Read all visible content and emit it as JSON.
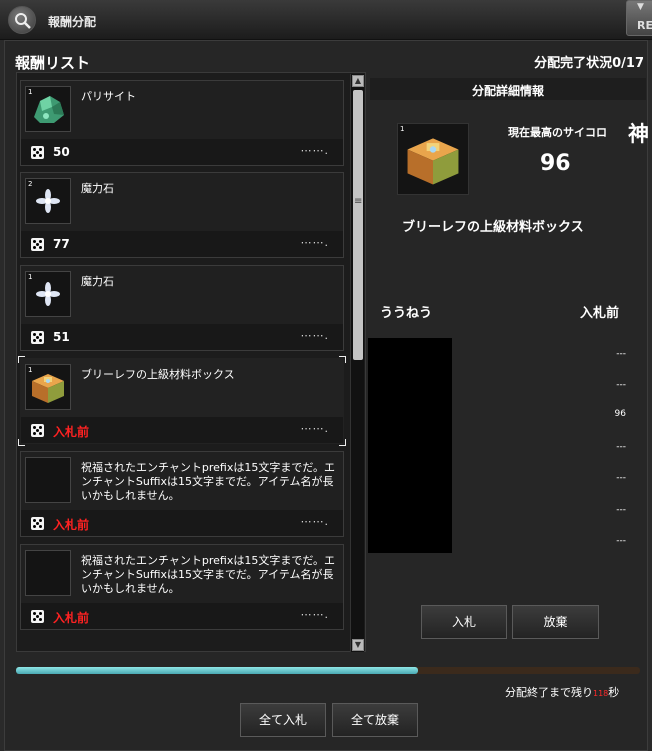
{
  "window": {
    "title": "報酬分配",
    "corner_button_label": "RE"
  },
  "header": {
    "list_title": "報酬リスト",
    "progress_status": "分配完了状況0/17"
  },
  "list_items": [
    {
      "qty": "1",
      "name": "パリサイト",
      "score": "50",
      "score_red": false,
      "icon": "green-ore-icon"
    },
    {
      "qty": "2",
      "name": "魔力石",
      "score": "77",
      "score_red": false,
      "icon": "magic-stone-icon"
    },
    {
      "qty": "1",
      "name": "魔力石",
      "score": "51",
      "score_red": false,
      "icon": "magic-stone-icon"
    },
    {
      "qty": "1",
      "name": "ブリーレフの上級材料ボックス",
      "score": "入札前",
      "score_red": true,
      "icon": "material-box-icon"
    },
    {
      "qty": "",
      "name": "祝福されたエンチャントprefixは15文字までだ。エンチャントSuffixは15文字までだ。アイテム名が長いかもしれません。",
      "score": "入札前",
      "score_red": true,
      "icon": "empty-slot"
    },
    {
      "qty": "",
      "name": "祝福されたエンチャントprefixは15文字までだ。エンチャントSuffixは15文字までだ。アイテム名が長いかもしれません。",
      "score": "入札前",
      "score_red": true,
      "icon": "empty-slot"
    }
  ],
  "more_indicator": "⋯⋯.",
  "detail": {
    "title": "分配詳細情報",
    "item_qty": "1",
    "highest_roll_label": "現在最高のサイコロ",
    "god_glyph": "神",
    "highest_roll_value": "96",
    "item_name": "ブリーレフの上級材料ボックス",
    "bidder_header": "ううねう",
    "bid_status_header": "入札前",
    "bid_values": [
      "---",
      "---",
      "96",
      "---",
      "---",
      "---",
      "---"
    ]
  },
  "buttons": {
    "bid": "入札",
    "pass": "放棄",
    "bid_all": "全て入札",
    "pass_all": "全て放棄"
  },
  "timer": {
    "progress": 0.645,
    "label_prefix": "分配終了まで残り",
    "seconds": "118",
    "label_suffix": "秒"
  },
  "colors": {
    "accent_red": "#ff2222",
    "timer_fill": "#6cc9cf"
  }
}
